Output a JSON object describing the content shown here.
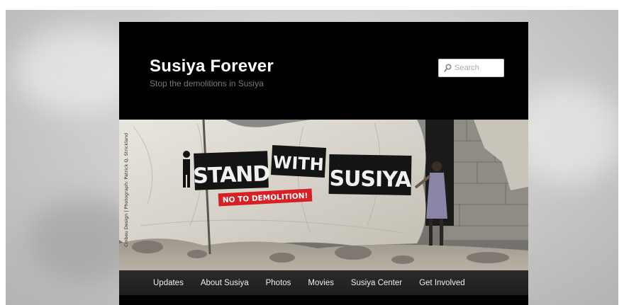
{
  "site": {
    "title": "Susiya Forever",
    "description": "Stop the demolitions in Susiya"
  },
  "search": {
    "placeholder": "Search"
  },
  "banner": {
    "sign_words": [
      "STAND",
      "WITH",
      "SUSIYA"
    ],
    "sticker": "NO TO DEMOLITION!",
    "credit": "Cinbou Design  |  Photograph: Patrick Q. Strickland"
  },
  "nav": {
    "items": [
      {
        "label": "Updates"
      },
      {
        "label": "About Susiya"
      },
      {
        "label": "Photos"
      },
      {
        "label": "Movies"
      },
      {
        "label": "Susiya Center"
      },
      {
        "label": "Get Involved"
      }
    ]
  },
  "colors": {
    "page_background": "#000000",
    "title": "#ffffff",
    "description": "#7a7a7a",
    "nav_background": "#222222",
    "sticker_red": "#d71f26",
    "outer_background": "#c8c8c8"
  }
}
